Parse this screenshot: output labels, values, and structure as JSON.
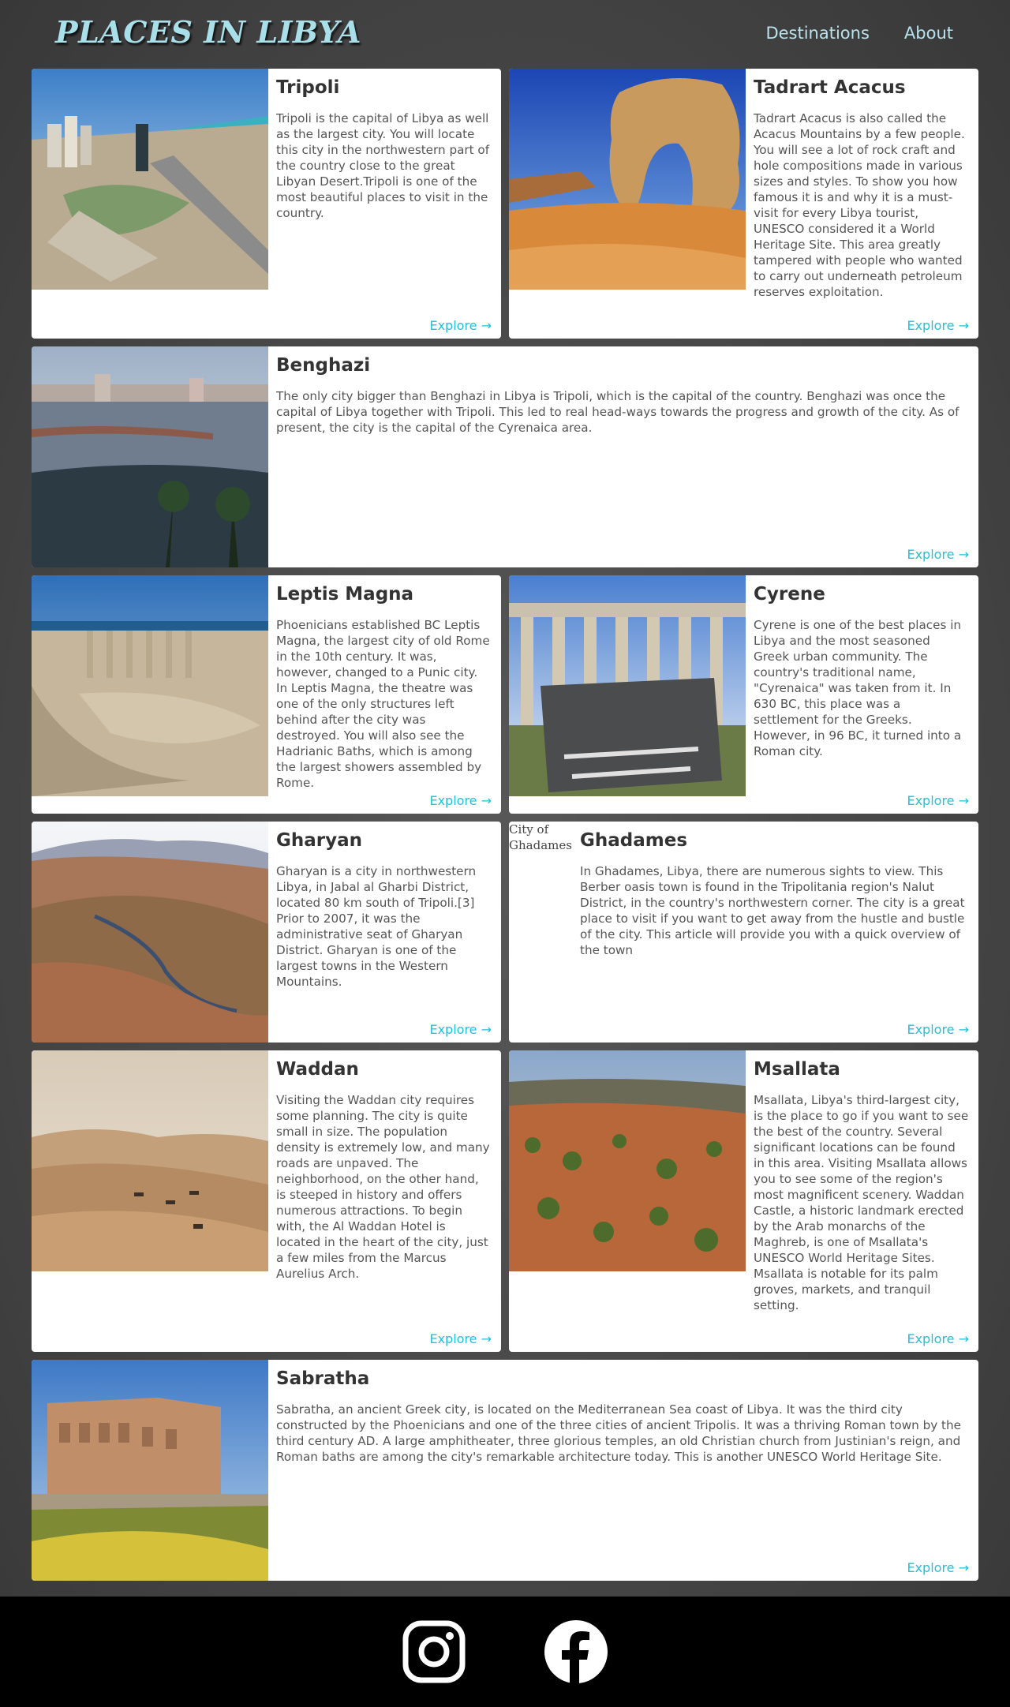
{
  "header": {
    "logo": "PLACES IN LIBYA",
    "nav": [
      {
        "label": "Destinations"
      },
      {
        "label": "About"
      }
    ]
  },
  "explore_label": "Explore →",
  "cards": [
    {
      "title": "Tripoli",
      "text": "Tripoli is the capital of Libya as well as the largest city. You will locate this city in the northwestern part of the country close to the great Libyan Desert.Tripoli is one of the most beautiful places to visit in the country."
    },
    {
      "title": "Tadrart Acacus",
      "text": "Tadrart Acacus is also called the Acacus Mountains by a few people. You will see a lot of rock craft and hole compositions made in various sizes and styles. To show you how famous it is and why it is a must-visit for every Libya tourist, UNESCO considered it a World Heritage Site. This area greatly tampered with people who wanted to carry out underneath petroleum reserves exploitation."
    },
    {
      "title": "Benghazi",
      "text": "The only city bigger than Benghazi in Libya is Tripoli, which is the capital of the country. Benghazi was once the capital of Libya together with Tripoli. This led to real head-ways towards the progress and growth of the city. As of present, the city is the capital of the Cyrenaica area."
    },
    {
      "title": "Leptis Magna",
      "text": "Phoenicians established BC Leptis Magna, the largest city of old Rome in the 10th century. It was, however, changed to a Punic city. In Leptis Magna, the theatre was one of the only structures left behind after the city was destroyed. You will also see the Hadrianic Baths, which is among the largest showers assembled by Rome."
    },
    {
      "title": "Cyrene",
      "text": "Cyrene is one of the best places in Libya and the most seasoned Greek urban community. The country's traditional name, \"Cyrenaica\" was taken from it. In 630 BC, this place was a settlement for the Greeks. However, in 96 BC, it turned into a Roman city."
    },
    {
      "title": "Gharyan",
      "text": "Gharyan is a city in northwestern Libya, in Jabal al Gharbi District, located 80 km south of Tripoli.[3] Prior to 2007, it was the administrative seat of Gharyan District. Gharyan is one of the largest towns in the Western Mountains."
    },
    {
      "title": "Ghadames",
      "alt": "City of Ghadames",
      "text": "In Ghadames, Libya, there are numerous sights to view. This Berber oasis town is found in the Tripolitania region's Nalut District, in the country's northwestern corner. The city is a great place to visit if you want to get away from the hustle and bustle of the city. This article will provide you with a quick overview of the town"
    },
    {
      "title": "Waddan",
      "text": "Visiting the Waddan city requires some planning. The city is quite small in size. The population density is extremely low, and many roads are unpaved. The neighborhood, on the other hand, is steeped in history and offers numerous attractions. To begin with, the Al Waddan Hotel is located in the heart of the city, just a few miles from the Marcus Aurelius Arch."
    },
    {
      "title": "Msallata",
      "text": "Msallata, Libya's third-largest city, is the place to go if you want to see the best of the country. Several significant locations can be found in this area. Visiting Msallata allows you to see some of the region's most magnificent scenery. Waddan Castle, a historic landmark erected by the Arab monarchs of the Maghreb, is one of Msallata's UNESCO World Heritage Sites. Msallata is notable for its palm groves, markets, and tranquil setting."
    },
    {
      "title": "Sabratha",
      "text": "Sabratha, an ancient Greek city, is located on the Mediterranean Sea coast of Libya. It was the third city constructed by the Phoenicians and one of the three cities of ancient Tripolis. It was a thriving Roman town by the third century AD. A large amphitheater, three glorious temples, an old Christian church from Justinian's reign, and Roman baths are among the city's remarkable architecture today. This is another UNESCO World Heritage Site."
    }
  ],
  "footer": {
    "icons": [
      "instagram-icon",
      "facebook-icon"
    ]
  }
}
